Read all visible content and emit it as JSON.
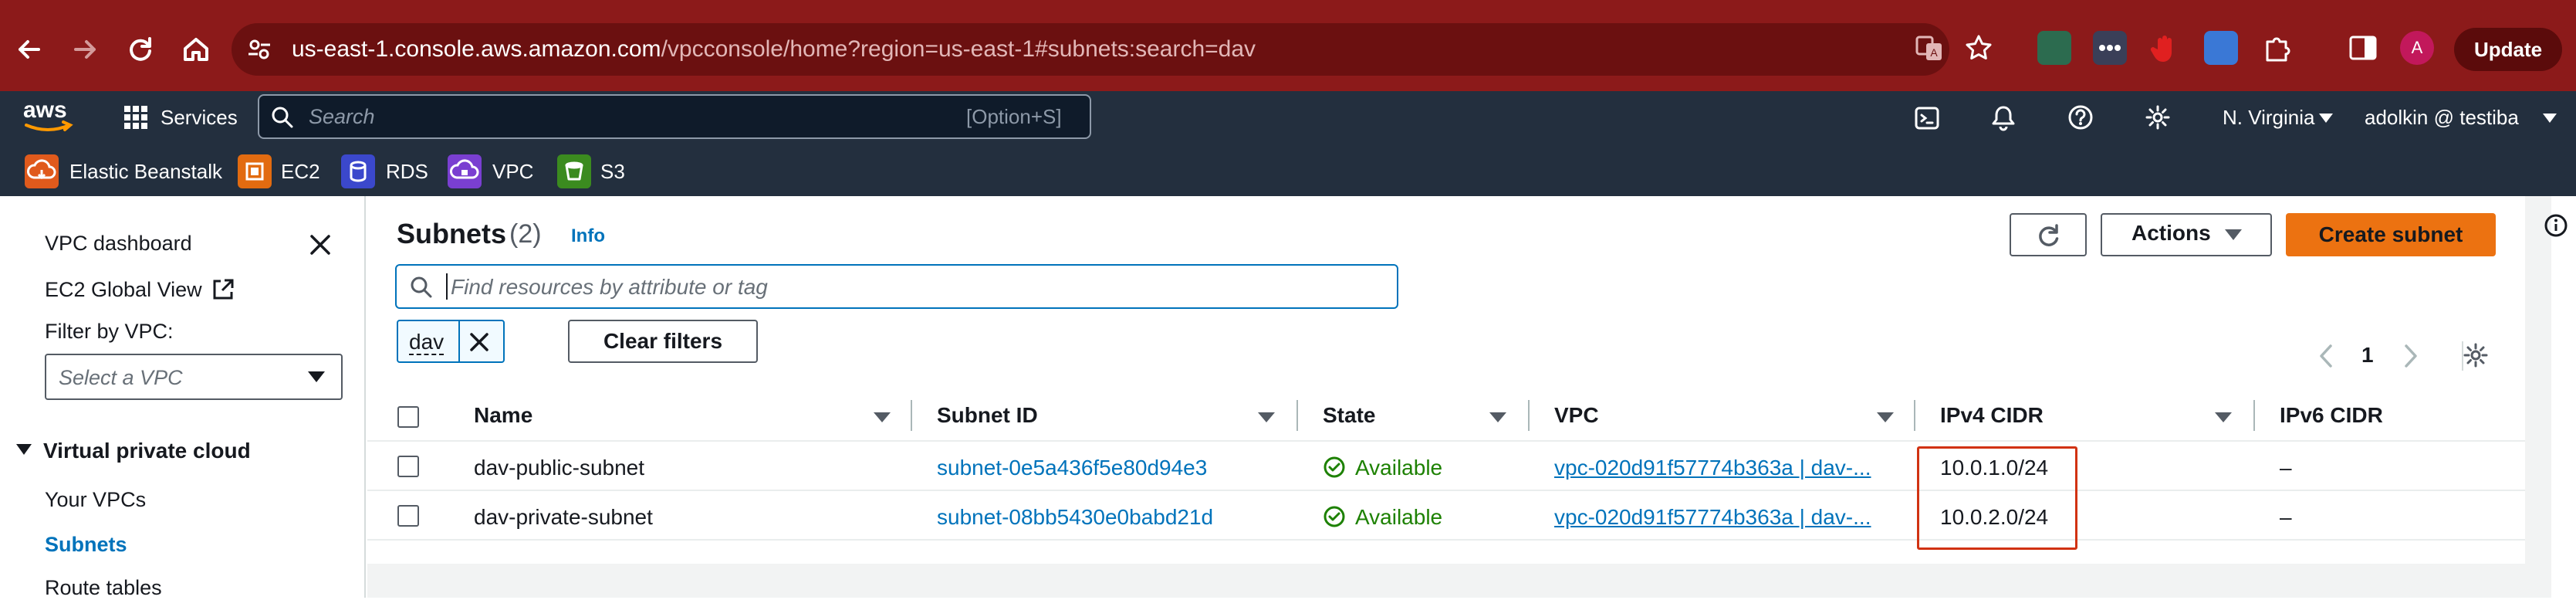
{
  "browser": {
    "url_host": "us-east-1.console.aws.amazon.com",
    "url_path": "/vpcconsole/home?region=us-east-1#subnets:search=dav",
    "update_label": "Update",
    "profile_initial": "A"
  },
  "console_header": {
    "services_label": "Services",
    "search_placeholder": "Search",
    "search_shortcut": "[Option+S]",
    "region": "N. Virginia",
    "account": "adolkin @ testiba"
  },
  "favorites": [
    {
      "label": "Elastic Beanstalk",
      "color": "#e05a1c"
    },
    {
      "label": "EC2",
      "color": "#e26b10"
    },
    {
      "label": "RDS",
      "color": "#3b48cc"
    },
    {
      "label": "VPC",
      "color": "#7a3fd1"
    },
    {
      "label": "S3",
      "color": "#3b8b1f"
    }
  ],
  "sidebar": {
    "dashboard": "VPC dashboard",
    "global_view": "EC2 Global View",
    "filter_label": "Filter by VPC:",
    "select_placeholder": "Select a VPC",
    "section": "Virtual private cloud",
    "items": [
      "Your VPCs",
      "Subnets",
      "Route tables"
    ]
  },
  "main": {
    "title": "Subnets",
    "count": "(2)",
    "info": "Info",
    "refresh_icon": "refresh-icon",
    "actions_label": "Actions",
    "create_label": "Create subnet",
    "filter_placeholder": "Find resources by attribute or tag",
    "filter_token": "dav",
    "clear_filters": "Clear filters",
    "page_number": "1"
  },
  "table": {
    "columns": [
      "Name",
      "Subnet ID",
      "State",
      "VPC",
      "IPv4 CIDR",
      "IPv6 CIDR"
    ],
    "rows": [
      {
        "name": "dav-public-subnet",
        "subnet_id": "subnet-0e5a436f5e80d94e3",
        "state": "Available",
        "vpc": "vpc-020d91f57774b363a | dav-...",
        "ipv4": "10.0.1.0/24",
        "ipv6": "–"
      },
      {
        "name": "dav-private-subnet",
        "subnet_id": "subnet-08bb5430e0babd21d",
        "state": "Available",
        "vpc": "vpc-020d91f57774b363a | dav-...",
        "ipv4": "10.0.2.0/24",
        "ipv6": "–"
      }
    ]
  },
  "colors": {
    "browser_chrome": "#8c1a1a",
    "console_header": "#232f3e",
    "link": "#0073bb",
    "primary_button": "#ec7211",
    "available_green": "#1d8102",
    "highlight_red": "#d13212"
  }
}
